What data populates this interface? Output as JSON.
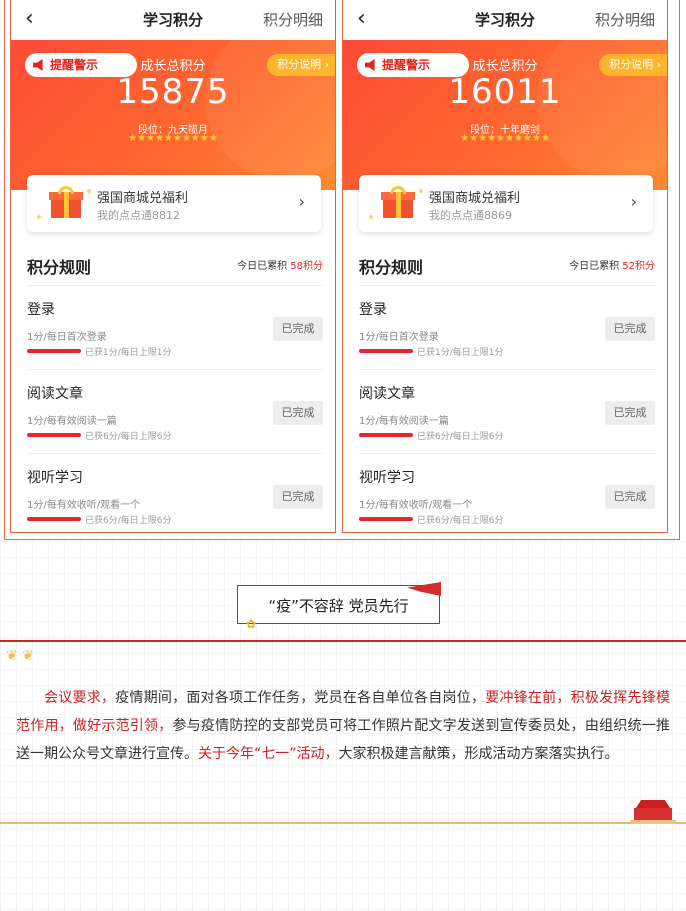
{
  "phones": [
    {
      "title": "学习积分",
      "detail_link": "积分明细",
      "alert_label": "提醒警示",
      "explain_label": "积分说明 ›",
      "growth_label": "成长总积分",
      "total_score": "15875",
      "rank": "段位：九天揽月",
      "stars": "★★★★★★★★★★",
      "mall_title": "强国商城兑福利",
      "mall_sub": "我的点点通8812",
      "rules_title": "积分规则",
      "today_prefix": "今日已累积",
      "today_value": "58积分",
      "rules": [
        {
          "name": "登录",
          "desc": "1分/每日首次登录",
          "progress": "已获1分/每日上限1分",
          "status": "已完成",
          "progress_fraction": 1.0
        },
        {
          "name": "阅读文章",
          "desc": "1分/每有效阅读一篇",
          "progress": "已获6分/每日上限6分",
          "status": "已完成",
          "progress_fraction": 1.0
        },
        {
          "name": "视听学习",
          "desc": "1分/每有效收听/观看一个",
          "progress": "已获6分/每日上限6分",
          "status": "已完成",
          "progress_fraction": 1.0
        }
      ]
    },
    {
      "title": "学习积分",
      "detail_link": "积分明细",
      "alert_label": "提醒警示",
      "explain_label": "积分说明 ›",
      "growth_label": "成长总积分",
      "total_score": "16011",
      "rank": "段位：十年磨剑",
      "stars": "★★★★★★★★★★",
      "mall_title": "强国商城兑福利",
      "mall_sub": "我的点点通8869",
      "rules_title": "积分规则",
      "today_prefix": "今日已累积",
      "today_value": "52积分",
      "rules": [
        {
          "name": "登录",
          "desc": "1分/每日首次登录",
          "progress": "已获1分/每日上限1分",
          "status": "已完成",
          "progress_fraction": 1.0
        },
        {
          "name": "阅读文章",
          "desc": "1分/每有效阅读一篇",
          "progress": "已获6分/每日上限6分",
          "status": "已完成",
          "progress_fraction": 1.0
        },
        {
          "name": "视听学习",
          "desc": "1分/每有效收听/观看一个",
          "progress": "已获6分/每日上限6分",
          "status": "已完成",
          "progress_fraction": 1.0
        }
      ]
    }
  ],
  "article": {
    "banner_title": "“疫”不容辞 党员先行",
    "paragraph": {
      "p1": "会议要求，",
      "p2": "疫情期间，面对各项工作任务，党员在各自单位各自岗位，",
      "p3": "要冲锋在前，积极发挥先锋模范作用，做好示范引领，",
      "p4": "参与疫情防控的支部党员可将工作照片配文字发送到宣传委员处，由组织统一推送一期公众号文章进行宣传。",
      "p5": "关于今年“七一”活动，",
      "p6": "大家积极建言献策，形成活动方案落实执行。"
    }
  },
  "colors": {
    "accent_red": "#e2241c",
    "hero_orange": "#ff5a32",
    "star_gold": "#ffcf3a",
    "explain_yellow": "#ffb020"
  },
  "icons": [
    "back-arrow-icon",
    "speaker-icon",
    "gift-icon",
    "chevron-right-icon",
    "flag-icon",
    "leaves-icon",
    "tiananmen-icon"
  ]
}
